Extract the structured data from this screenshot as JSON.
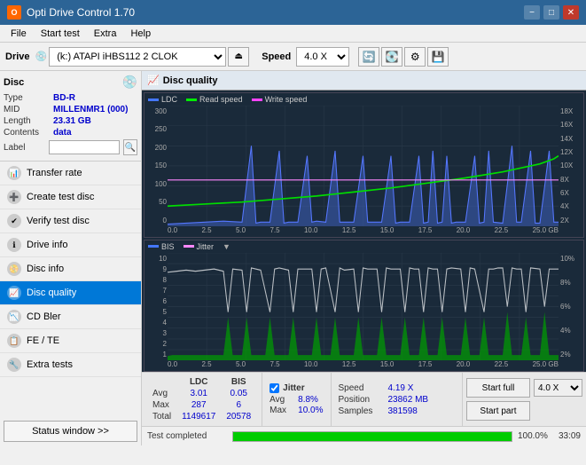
{
  "titleBar": {
    "title": "Opti Drive Control 1.70",
    "icon": "O",
    "minimize": "−",
    "maximize": "□",
    "close": "✕"
  },
  "menuBar": {
    "items": [
      "File",
      "Start test",
      "Extra",
      "Help"
    ]
  },
  "driveToolbar": {
    "label": "Drive",
    "driveValue": "(k:) ATAPI iHBS112  2 CLOK",
    "speedLabel": "Speed",
    "speedValue": "4.0 X"
  },
  "disc": {
    "title": "Disc",
    "typeLabel": "Type",
    "typeValue": "BD-R",
    "midLabel": "MID",
    "midValue": "MILLENMR1 (000)",
    "lengthLabel": "Length",
    "lengthValue": "23.31 GB",
    "contentsLabel": "Contents",
    "contentsValue": "data",
    "labelLabel": "Label"
  },
  "navigation": {
    "items": [
      {
        "id": "transfer-rate",
        "label": "Transfer rate",
        "active": false
      },
      {
        "id": "create-test-disc",
        "label": "Create test disc",
        "active": false
      },
      {
        "id": "verify-test-disc",
        "label": "Verify test disc",
        "active": false
      },
      {
        "id": "drive-info",
        "label": "Drive info",
        "active": false
      },
      {
        "id": "disc-info",
        "label": "Disc info",
        "active": false
      },
      {
        "id": "disc-quality",
        "label": "Disc quality",
        "active": true
      },
      {
        "id": "cd-bler",
        "label": "CD Bler",
        "active": false
      },
      {
        "id": "fe-te",
        "label": "FE / TE",
        "active": false
      },
      {
        "id": "extra-tests",
        "label": "Extra tests",
        "active": false
      }
    ],
    "statusButton": "Status window >>"
  },
  "discQuality": {
    "title": "Disc quality",
    "legend": {
      "ldc": "LDC",
      "readSpeed": "Read speed",
      "writeSpeed": "Write speed"
    },
    "legend2": {
      "bis": "BIS",
      "jitter": "Jitter"
    },
    "xLabels": [
      "0.0",
      "2.5",
      "5.0",
      "7.5",
      "10.0",
      "12.5",
      "15.0",
      "17.5",
      "20.0",
      "22.5",
      "25.0 GB"
    ],
    "yLabels1Left": [
      "300",
      "250",
      "200",
      "150",
      "100",
      "50",
      "0"
    ],
    "yLabels1Right": [
      "18X",
      "16X",
      "14X",
      "12X",
      "10X",
      "8X",
      "6X",
      "4X",
      "2X"
    ],
    "yLabels2Left": [
      "10",
      "9",
      "8",
      "7",
      "6",
      "5",
      "4",
      "3",
      "2",
      "1"
    ],
    "yLabels2Right": [
      "10%",
      "8%",
      "6%",
      "4%",
      "2%"
    ]
  },
  "stats": {
    "headers": [
      "",
      "LDC",
      "BIS"
    ],
    "avgLabel": "Avg",
    "avgLdc": "3.01",
    "avgBis": "0.05",
    "maxLabel": "Max",
    "maxLdc": "287",
    "maxBis": "6",
    "totalLabel": "Total",
    "totalLdc": "1149617",
    "totalBis": "20578",
    "jitterLabel": "Jitter",
    "jitterAvg": "8.8%",
    "jitterMax": "10.0%",
    "speedLabel": "Speed",
    "speedValue": "4.19 X",
    "positionLabel": "Position",
    "positionValue": "23862 MB",
    "samplesLabel": "Samples",
    "samplesValue": "381598",
    "speedSelectValue": "4.0 X",
    "startFullLabel": "Start full",
    "startPartLabel": "Start part"
  },
  "progress": {
    "fillPercent": 100,
    "label": "100.0%",
    "time": "33:09"
  },
  "statusBar": {
    "text": "Test completed"
  }
}
